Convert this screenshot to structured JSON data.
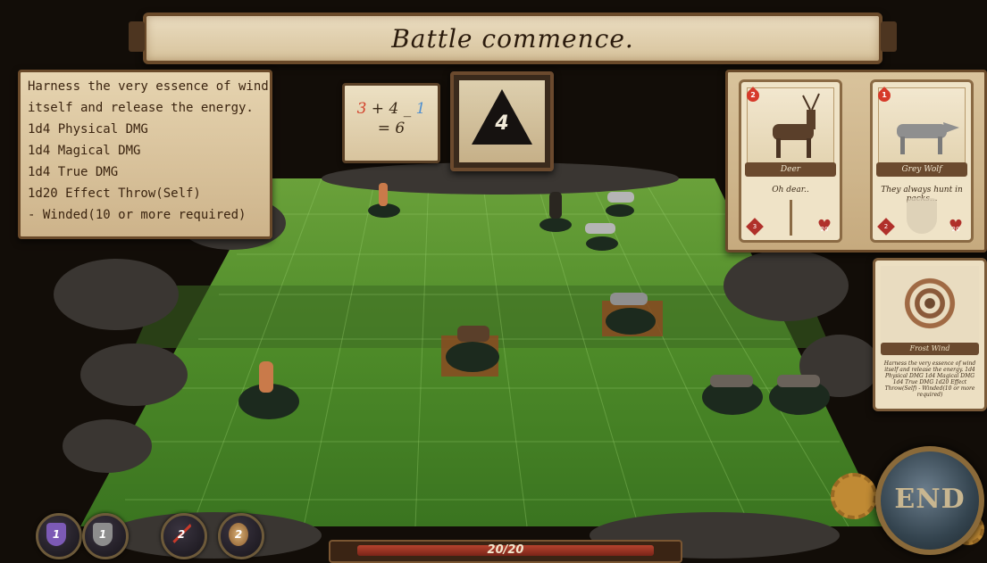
{
  "banner": {
    "title": "Battle commence."
  },
  "description": {
    "lines": [
      "Harness the very essence of wind",
      "itself and release the energy.",
      "1d4 Physical DMG",
      "1d4 Magical DMG",
      "1d4 True DMG",
      "1d20 Effect Throw(Self)",
      "- Winded(10 or more required)"
    ]
  },
  "roll": {
    "term_a": "3",
    "op_plus": "+",
    "term_b": "4",
    "op_minus": "_",
    "term_c": "1",
    "result": "= 6",
    "die_value": "4"
  },
  "enemies": [
    {
      "name": "Deer",
      "flavor": "Oh dear..",
      "blood": "2",
      "attack": "3",
      "hp": "20"
    },
    {
      "name": "Grey Wolf",
      "flavor": "They always hunt in packs...",
      "blood": "1",
      "attack": "2",
      "hp": "20"
    }
  ],
  "ability_card": {
    "name": "Frost Wind",
    "text": "Harness the very essence of wind itself and release the energy. 1d4 Physical DMG 1d4 Magical DMG 1d4 True DMG 1d20 Effect Throw(Self) - Winded(10 or more required)"
  },
  "player": {
    "hp_text": "20/20"
  },
  "resources": {
    "magic_shield": "1",
    "armor": "1",
    "attack": "2",
    "tokens": "2"
  },
  "end_button": {
    "label": "END"
  },
  "colors": {
    "board": "#4f8a2a",
    "parchment": "#e6d4b0",
    "frame": "#6a4a2a"
  }
}
